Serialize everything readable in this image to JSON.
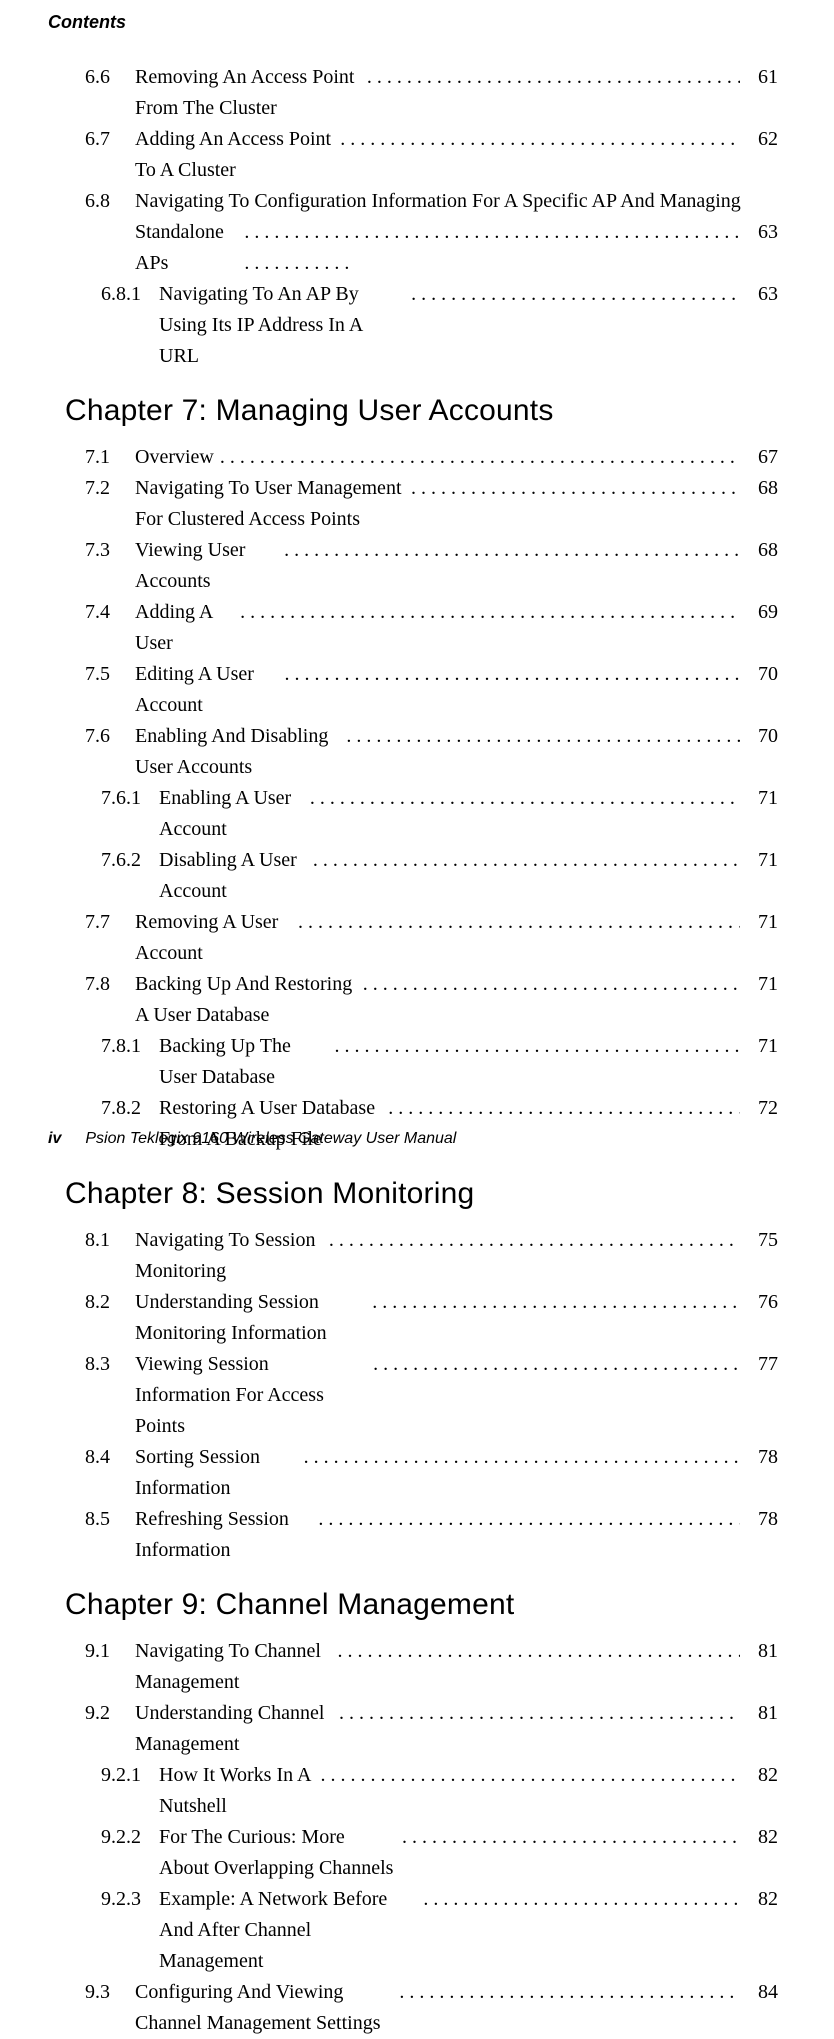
{
  "running_head": "Contents",
  "footer": {
    "pageno": "iv",
    "text": "Psion Teklogix 9160 Wireless Gateway User Manual"
  },
  "pre_entries": [
    {
      "num": "6.6",
      "title": "Removing An Access Point From The Cluster",
      "page": "61",
      "indent": 0
    },
    {
      "num": "6.7",
      "title": "Adding An Access Point To A Cluster",
      "page": "62",
      "indent": 0
    }
  ],
  "entry_68": {
    "num": "6.8",
    "line1": "Navigating To Configuration Information For A Specific AP And Managing",
    "line2": "Standalone APs",
    "page": "63"
  },
  "entry_681": {
    "num": "6.8.1",
    "title": "Navigating To An AP By Using Its IP Address In A URL",
    "page": "63",
    "indent": 1
  },
  "ch7": {
    "heading": "Chapter 7:  Managing User Accounts",
    "entries": [
      {
        "num": "7.1",
        "title": "Overview",
        "page": "67",
        "indent": 0
      },
      {
        "num": "7.2",
        "title": "Navigating To User Management For Clustered Access Points",
        "page": "68",
        "indent": 0
      },
      {
        "num": "7.3",
        "title": "Viewing User Accounts",
        "page": "68",
        "indent": 0
      },
      {
        "num": "7.4",
        "title": "Adding A User",
        "page": "69",
        "indent": 0
      },
      {
        "num": "7.5",
        "title": "Editing A User Account",
        "page": "70",
        "indent": 0
      },
      {
        "num": "7.6",
        "title": "Enabling And Disabling User Accounts",
        "page": "70",
        "indent": 0
      },
      {
        "num": "7.6.1",
        "title": "Enabling A User Account",
        "page": "71",
        "indent": 1
      },
      {
        "num": "7.6.2",
        "title": "Disabling A User Account",
        "page": "71",
        "indent": 1
      },
      {
        "num": "7.7",
        "title": "Removing A User Account",
        "page": "71",
        "indent": 0
      },
      {
        "num": "7.8",
        "title": "Backing Up And Restoring A User Database",
        "page": "71",
        "indent": 0
      },
      {
        "num": "7.8.1",
        "title": "Backing Up The User Database",
        "page": "71",
        "indent": 1
      },
      {
        "num": "7.8.2",
        "title": "Restoring A User Database From A Backup File",
        "page": "72",
        "indent": 1
      }
    ]
  },
  "ch8": {
    "heading": "Chapter 8:  Session Monitoring",
    "entries": [
      {
        "num": "8.1",
        "title": "Navigating To Session Monitoring",
        "page": "75",
        "indent": 0
      },
      {
        "num": "8.2",
        "title": "Understanding Session Monitoring Information",
        "page": "76",
        "indent": 0
      },
      {
        "num": "8.3",
        "title": "Viewing Session Information For Access Points",
        "page": "77",
        "indent": 0
      },
      {
        "num": "8.4",
        "title": "Sorting Session Information",
        "page": "78",
        "indent": 0
      },
      {
        "num": "8.5",
        "title": "Refreshing Session Information",
        "page": "78",
        "indent": 0
      }
    ]
  },
  "ch9": {
    "heading": "Chapter 9:  Channel Management",
    "entries": [
      {
        "num": "9.1",
        "title": "Navigating To Channel Management",
        "page": "81",
        "indent": 0
      },
      {
        "num": "9.2",
        "title": "Understanding Channel Management",
        "page": "81",
        "indent": 0
      },
      {
        "num": "9.2.1",
        "title": "How It Works In A Nutshell",
        "page": "82",
        "indent": 1
      },
      {
        "num": "9.2.2",
        "title": "For The Curious: More About Overlapping Channels",
        "page": "82",
        "indent": 1
      },
      {
        "num": "9.2.3",
        "title": "Example: A Network Before And After Channel Management",
        "page": "82",
        "indent": 1
      },
      {
        "num": "9.3",
        "title": "Configuring And Viewing Channel Management Settings",
        "page": "84",
        "indent": 0
      }
    ]
  }
}
